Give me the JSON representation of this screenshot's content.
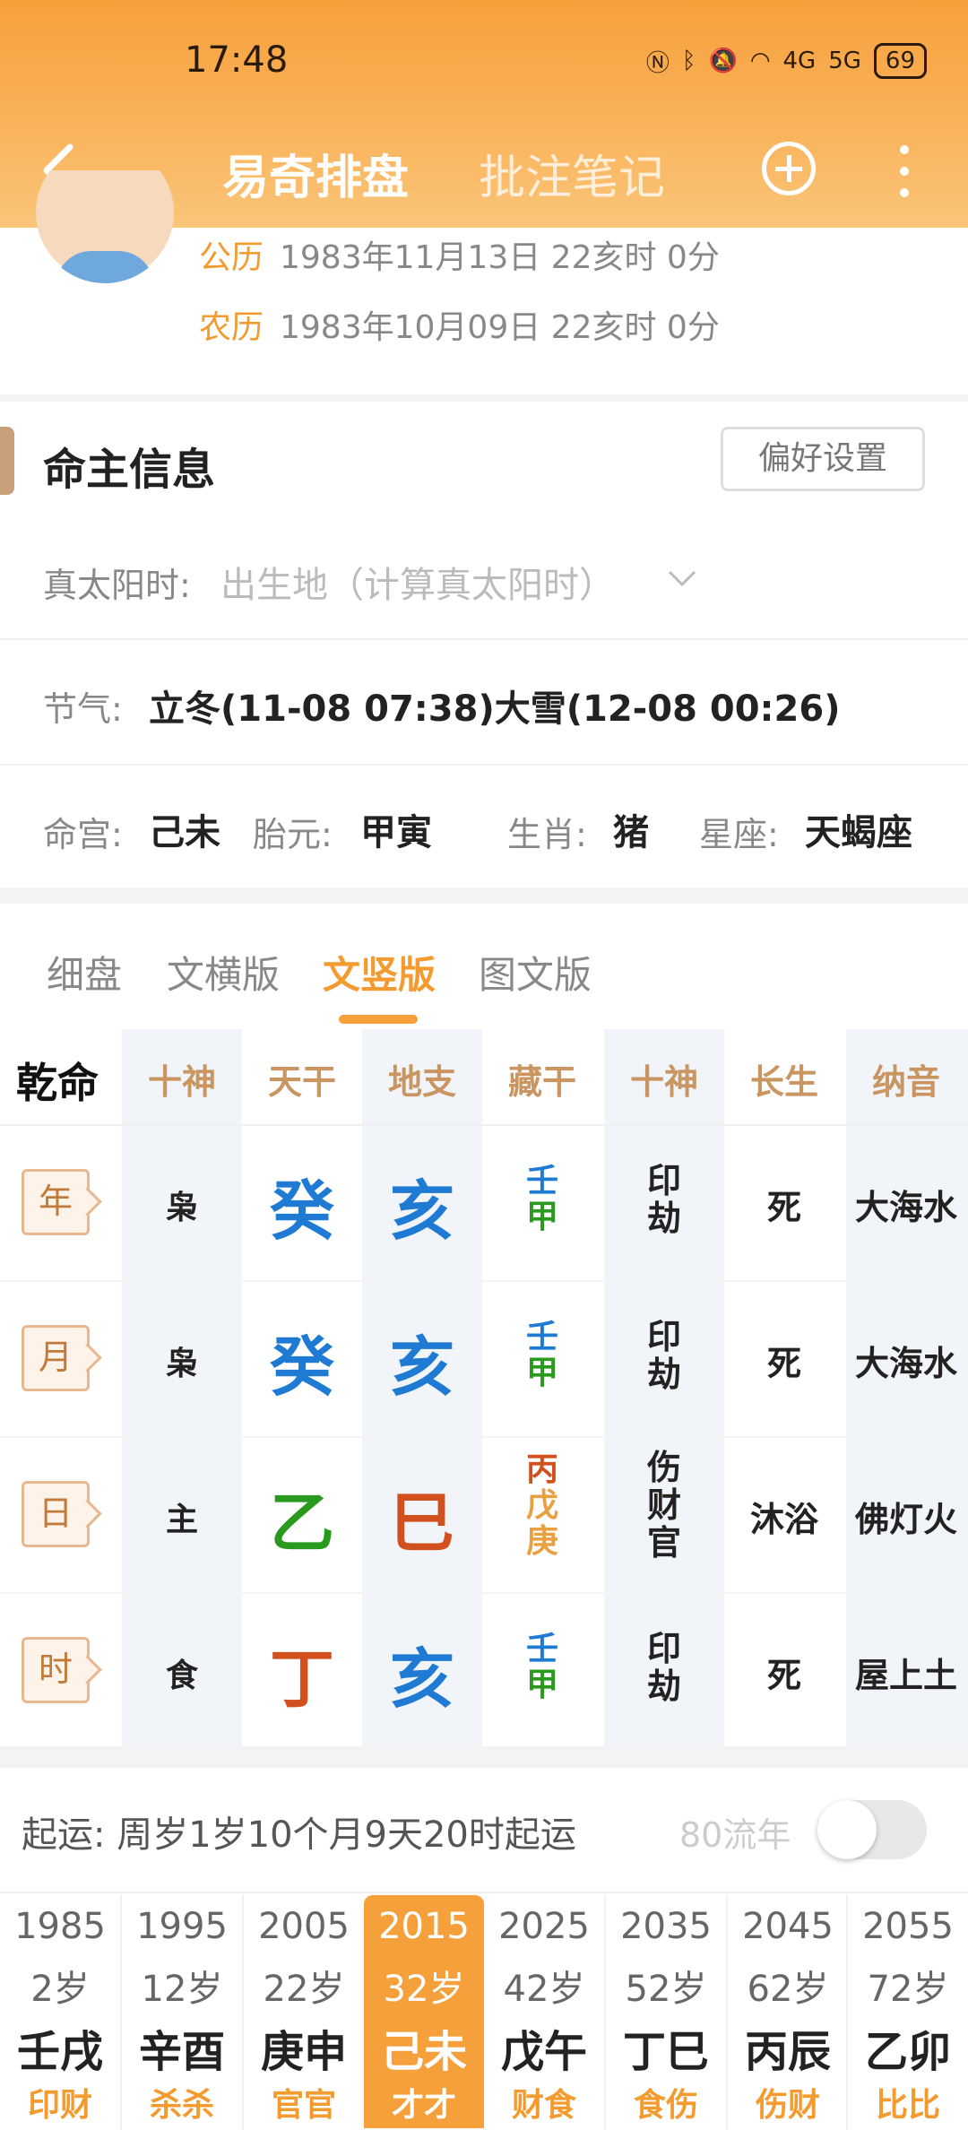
{
  "status": {
    "time": "17:48",
    "battery": "69",
    "signal1": "4G",
    "signal2": "5G"
  },
  "nav": {
    "title": "易奇排盘",
    "tab2": "批注笔记"
  },
  "profile": {
    "solar_label": "公历",
    "solar_value": "1983年11月13日 22亥时 0分",
    "lunar_label": "农历",
    "lunar_value": "1983年10月09日 22亥时 0分"
  },
  "section": {
    "title": "命主信息",
    "pref_button": "偏好设置"
  },
  "true_solar": {
    "label": "真太阳时:",
    "placeholder": "出生地（计算真太阳时）"
  },
  "jieqi": {
    "label": "节气:",
    "value": "立冬(11-08 07:38)大雪(12-08 00:26)"
  },
  "info": {
    "minggong_label": "命宫:",
    "minggong": "己未",
    "taiyuan_label": "胎元:",
    "taiyuan": "甲寅",
    "shengxiao_label": "生肖:",
    "shengxiao": "猪",
    "xingzuo_label": "星座:",
    "xingzuo": "天蝎座"
  },
  "view_tabs": [
    "细盘",
    "文横版",
    "文竖版",
    "图文版"
  ],
  "table": {
    "corner": "乾命",
    "headers": [
      "十神",
      "天干",
      "地支",
      "藏干",
      "十神",
      "长生",
      "纳音"
    ],
    "rows": [
      {
        "tag": "年",
        "shishen": "枭",
        "gan": "癸",
        "zhi": "亥",
        "canggan": [
          "壬",
          "甲"
        ],
        "shishen2": [
          "印",
          "劫"
        ],
        "changsheng": "死",
        "nayin": "大海水"
      },
      {
        "tag": "月",
        "shishen": "枭",
        "gan": "癸",
        "zhi": "亥",
        "canggan": [
          "壬",
          "甲"
        ],
        "shishen2": [
          "印",
          "劫"
        ],
        "changsheng": "死",
        "nayin": "大海水"
      },
      {
        "tag": "日",
        "shishen": "主",
        "gan": "乙",
        "zhi": "巳",
        "canggan": [
          "丙",
          "戊",
          "庚"
        ],
        "shishen2": [
          "伤",
          "财",
          "官"
        ],
        "changsheng": "沐浴",
        "nayin": "佛灯火"
      },
      {
        "tag": "时",
        "shishen": "食",
        "gan": "丁",
        "zhi": "亥",
        "canggan": [
          "壬",
          "甲"
        ],
        "shishen2": [
          "印",
          "劫"
        ],
        "changsheng": "死",
        "nayin": "屋上土"
      }
    ],
    "colors": {
      "water": "#1e7ad2",
      "wood": "#2a9a1e",
      "fire": "#d2501e",
      "earth": "#e8a040",
      "metal": "#e8a040"
    }
  },
  "qiyun": {
    "text": "起运:  周岁1岁10个月9天20时起运",
    "liunian_label": "80流年",
    "liunian_on": false
  },
  "dayun": [
    {
      "year": "1985",
      "age": "2岁",
      "gz": "壬戌",
      "sub": "印财"
    },
    {
      "year": "1995",
      "age": "12岁",
      "gz": "辛酉",
      "sub": "杀杀"
    },
    {
      "year": "2005",
      "age": "22岁",
      "gz": "庚申",
      "sub": "官官"
    },
    {
      "year": "2015",
      "age": "32岁",
      "gz": "己未",
      "sub": "才才",
      "selected": true
    },
    {
      "year": "2025",
      "age": "42岁",
      "gz": "戊午",
      "sub": "财食"
    },
    {
      "year": "2035",
      "age": "52岁",
      "gz": "丁巳",
      "sub": "食伤"
    },
    {
      "year": "2045",
      "age": "62岁",
      "gz": "丙辰",
      "sub": "伤财"
    },
    {
      "year": "2055",
      "age": "72岁",
      "gz": "乙卯",
      "sub": "比比"
    }
  ]
}
